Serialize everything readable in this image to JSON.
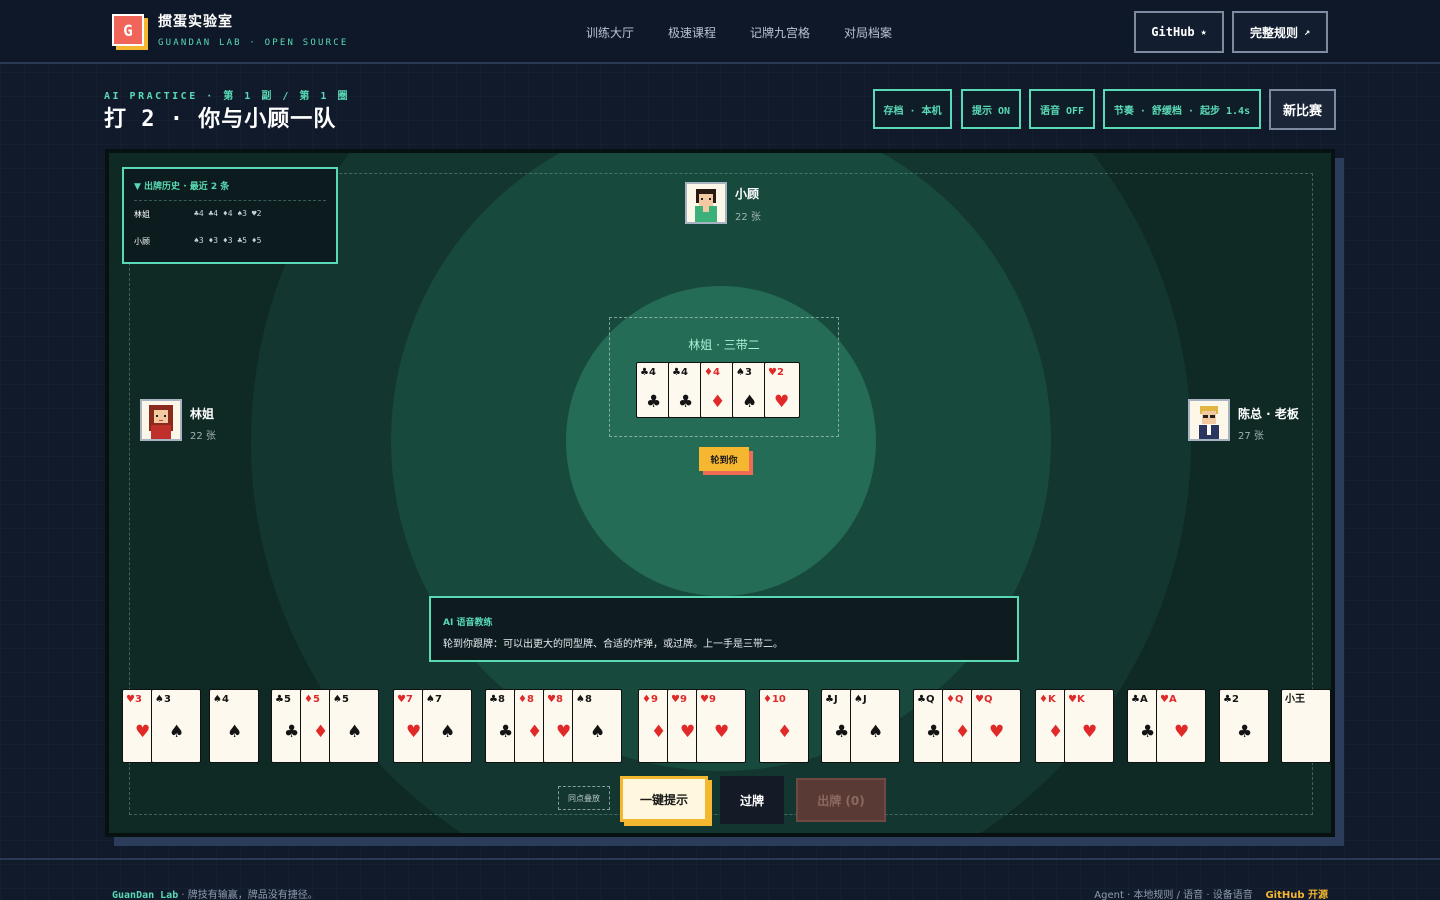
{
  "brand": {
    "logo_letter": "G",
    "title": "掼蛋实验室",
    "subtitle": "GUANDAN LAB · OPEN SOURCE"
  },
  "nav": [
    "训练大厅",
    "极速课程",
    "记牌九宫格",
    "对局档案"
  ],
  "header_buttons": {
    "github": "GitHub",
    "github_icon": "★",
    "rules": "完整规则",
    "rules_icon": "↗"
  },
  "game": {
    "eyebrow": "AI PRACTICE · 第 1 副 / 第 1 圈",
    "title": "打 2 · 你与小顾一队",
    "pills": [
      "存档 · 本机",
      "提示 ON",
      "语音 OFF",
      "节奏 · 舒缓档 · 起步 1.4s"
    ],
    "new_game": "新比赛"
  },
  "history": {
    "title": "▼ 出牌历史 · 最近 2 条",
    "rows": [
      {
        "player": "林姐",
        "cards": "♣4 ♣4 ♦4 ♠3 ♥2"
      },
      {
        "player": "小顾",
        "cards": "♠3 ♦3 ♦3 ♣5 ♦5"
      }
    ]
  },
  "players": {
    "top": {
      "name": "小顾",
      "count": "22 张"
    },
    "left": {
      "name": "林姐",
      "count": "22 张"
    },
    "right": {
      "name": "陈总 · 老板",
      "count": "27 张"
    }
  },
  "center": {
    "label": "林姐 · 三带二",
    "cards": [
      {
        "rank": "♣4",
        "suit": "♣",
        "color": "black"
      },
      {
        "rank": "♣4",
        "suit": "♣",
        "color": "black"
      },
      {
        "rank": "♦4",
        "suit": "♦",
        "color": "red"
      },
      {
        "rank": "♠3",
        "suit": "♠",
        "color": "black"
      },
      {
        "rank": "♥2",
        "suit": "♥",
        "color": "red"
      }
    ]
  },
  "turn_badge": "轮到你",
  "coach": {
    "title": "AI 语音教练",
    "text": "轮到你跟牌：可以出更大的同型牌、合适的炸弹，或过牌。上一手是三带二。"
  },
  "hand": [
    {
      "rank": "♥3",
      "suit": "♥",
      "color": "red"
    },
    {
      "rank": "♠3",
      "suit": "♠",
      "color": "black"
    },
    {
      "rank": "♠4",
      "suit": "♠",
      "color": "black"
    },
    {
      "rank": "♣5",
      "suit": "♣",
      "color": "black"
    },
    {
      "rank": "♦5",
      "suit": "♦",
      "color": "red"
    },
    {
      "rank": "♠5",
      "suit": "♠",
      "color": "black"
    },
    {
      "rank": "♥7",
      "suit": "♥",
      "color": "red"
    },
    {
      "rank": "♠7",
      "suit": "♠",
      "color": "black"
    },
    {
      "rank": "♣8",
      "suit": "♣",
      "color": "black"
    },
    {
      "rank": "♦8",
      "suit": "♦",
      "color": "red"
    },
    {
      "rank": "♥8",
      "suit": "♥",
      "color": "red"
    },
    {
      "rank": "♠8",
      "suit": "♠",
      "color": "black"
    },
    {
      "rank": "♦9",
      "suit": "♦",
      "color": "red"
    },
    {
      "rank": "♥9",
      "suit": "♥",
      "color": "red"
    },
    {
      "rank": "♥9",
      "suit": "♥",
      "color": "red"
    },
    {
      "rank": "♦10",
      "suit": "♦",
      "color": "red"
    },
    {
      "rank": "♣J",
      "suit": "♣",
      "color": "black"
    },
    {
      "rank": "♠J",
      "suit": "♠",
      "color": "black"
    },
    {
      "rank": "♣Q",
      "suit": "♣",
      "color": "black"
    },
    {
      "rank": "♦Q",
      "suit": "♦",
      "color": "red"
    },
    {
      "rank": "♥Q",
      "suit": "♥",
      "color": "red"
    },
    {
      "rank": "♦K",
      "suit": "♦",
      "color": "red"
    },
    {
      "rank": "♥K",
      "suit": "♥",
      "color": "red"
    },
    {
      "rank": "♣A",
      "suit": "♣",
      "color": "black"
    },
    {
      "rank": "♥A",
      "suit": "♥",
      "color": "red"
    },
    {
      "rank": "♣2",
      "suit": "♣",
      "color": "black"
    },
    {
      "rank": "小王",
      "suit": "",
      "color": "black"
    }
  ],
  "actions": {
    "same_point": "同点叠放",
    "hint": "一键提示",
    "pass": "过牌",
    "play": "出牌 (0)"
  },
  "footer": {
    "brand": "GuanDan Lab",
    "tagline": " · 牌技有输赢，牌品没有捷径。",
    "links": [
      "Agent",
      "本地规则",
      "语音",
      "设备语音"
    ],
    "github": "GitHub 开源"
  },
  "colors": {
    "accent": "#59d9b5",
    "gold": "#f5b730",
    "coral": "#f06a55",
    "felt": "#0f2a25",
    "bg": "#101a2b"
  }
}
